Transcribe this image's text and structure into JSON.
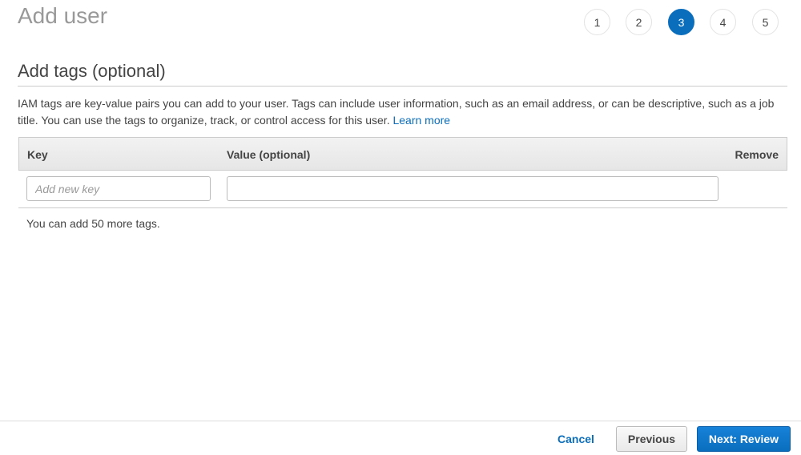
{
  "page": {
    "title": "Add user"
  },
  "steps": {
    "items": [
      {
        "label": "1",
        "active": false
      },
      {
        "label": "2",
        "active": false
      },
      {
        "label": "3",
        "active": true
      },
      {
        "label": "4",
        "active": false
      },
      {
        "label": "5",
        "active": false
      }
    ],
    "current": 3
  },
  "section": {
    "title": "Add tags (optional)",
    "description": "IAM tags are key-value pairs you can add to your user. Tags can include user information, such as an email address, or can be descriptive, such as a job title. You can use the tags to organize, track, or control access for this user.",
    "learn_more": "Learn more"
  },
  "table": {
    "headers": {
      "key": "Key",
      "value": "Value (optional)",
      "remove": "Remove"
    },
    "rows": [
      {
        "key_value": "",
        "key_placeholder": "Add new key",
        "value_value": "",
        "value_placeholder": ""
      }
    ]
  },
  "hint": "You can add 50 more tags.",
  "footer": {
    "cancel": "Cancel",
    "previous": "Previous",
    "next": "Next: Review"
  },
  "colors": {
    "accent": "#0a6ebd"
  }
}
